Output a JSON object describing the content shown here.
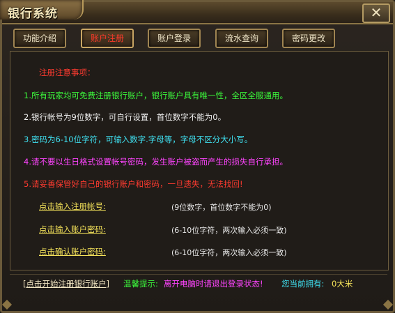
{
  "window": {
    "title": "银行系统",
    "close_label": "✕"
  },
  "tabs": [
    {
      "label": "功能介绍"
    },
    {
      "label": "账户注册"
    },
    {
      "label": "账户登录"
    },
    {
      "label": "流水查询"
    },
    {
      "label": "密码更改"
    }
  ],
  "notice": {
    "header": "注册注意事项：",
    "items": [
      "1.所有玩家均可免费注册银行账户，银行账户具有唯一性，全区全服通用。",
      "2.银行帐号为9位数字，可自行设置，首位数字不能为0。",
      "3.密码为6-10位字符，可输入数字.字母等，字母不区分大小写。",
      "4.请不要以生日格式设置帐号密码，发生账户被盗而产生的损失自行承担。",
      "5.请妥善保管好自己的银行账户和密码，一旦遗失，无法找回!"
    ]
  },
  "fields": [
    {
      "label": "点击输入注册帐号",
      "colon": ":",
      "hint": "(9位数字，首位数字不能为0)"
    },
    {
      "label": "点击输入账户密码",
      "colon": ":",
      "hint": "(6-10位字符，两次输入必须一致)"
    },
    {
      "label": "点击确认账户密码",
      "colon": ":",
      "hint": "(6-10位字符，两次输入必须一致)"
    }
  ],
  "footer": {
    "start_button": "点击开始注册银行账户",
    "tip_label": "温馨提示:",
    "tip_text": "离开电脑时请退出登录状态!",
    "holding_label": "您当前拥有:",
    "holding_value": "0大米"
  },
  "colors": {
    "accent_gold": "#a08552",
    "active_tab": "#ff3a2a",
    "green": "#3bf53b",
    "cyan": "#3fe0f0",
    "magenta": "#ff44ff",
    "red": "#ff3b30",
    "yellow": "#f5e35a"
  }
}
